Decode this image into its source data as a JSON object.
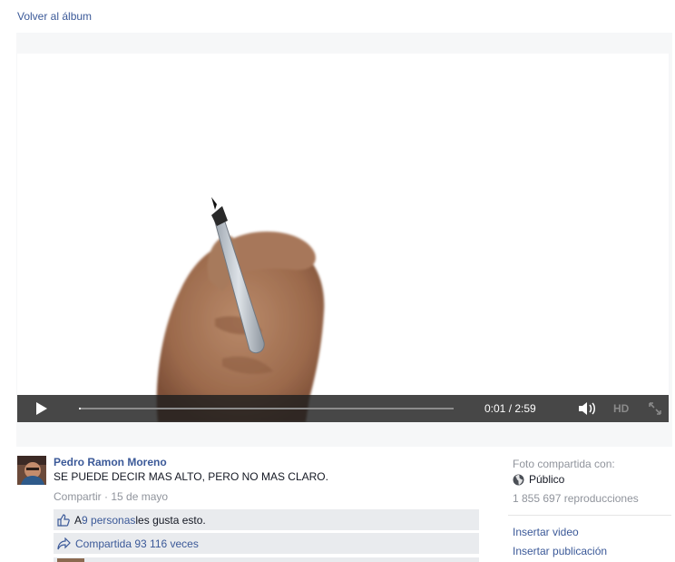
{
  "nav": {
    "back_label": "Volver al álbum"
  },
  "player": {
    "time_display": "0:01 / 2:59",
    "progress_fraction": 0.006,
    "hd_label": "HD"
  },
  "post": {
    "author": "Pedro Ramon Moreno",
    "message": "SE PUEDE DECIR MAS ALTO, PERO NO MAS CLARO.",
    "share_label": "Compartir",
    "separator": " · ",
    "date": "15 de mayo",
    "likes": {
      "prefix": "A ",
      "count_link": "9 personas",
      "suffix": " les gusta esto."
    },
    "shares_label": "Compartida 93 116 veces"
  },
  "sidebar": {
    "shared_with_label": "Foto compartida con:",
    "privacy_label": "Público",
    "views_label": "1 855 697 reproducciones",
    "embed_video_label": "Insertar video",
    "embed_post_label": "Insertar publicación"
  },
  "colors": {
    "link": "#3b5998",
    "muted": "#90949c",
    "ufi_bg": "#e9ebee",
    "controls_bg": "#1e1e1e"
  }
}
